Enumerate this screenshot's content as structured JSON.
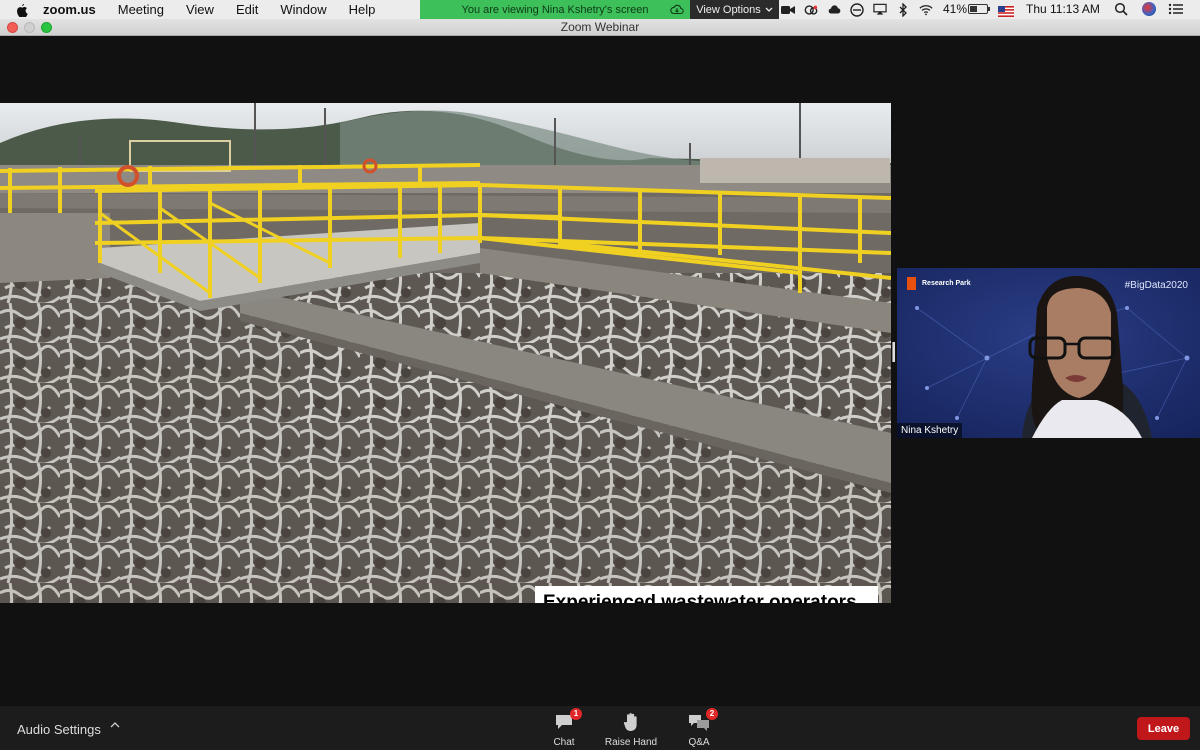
{
  "menubar": {
    "app_name": "zoom.us",
    "items": [
      "Meeting",
      "View",
      "Edit",
      "Window",
      "Help"
    ],
    "share_banner": "You are viewing Nina Kshetry's screen",
    "view_options": "View Options",
    "battery": "41%",
    "clock": "Thu 11:13 AM"
  },
  "window": {
    "title": "Zoom Webinar"
  },
  "shared_screen": {
    "caption": "Experienced wastewater operators are in short supply due to an aging workforce eligible for retirement and a lack of pipeline for new talent."
  },
  "video": {
    "logo_text": "Research Park",
    "hashtag": "#BigData2020",
    "participant_name": "Nina Kshetry"
  },
  "controls": {
    "audio_settings": "Audio Settings",
    "chat_label": "Chat",
    "chat_badge": "1",
    "raise_hand_label": "Raise Hand",
    "qa_label": "Q&A",
    "qa_badge": "2",
    "leave_label": "Leave"
  },
  "colors": {
    "share_banner": "#3dbf5a",
    "leave_button": "#c0171b",
    "badge": "#e02828",
    "railing": "#f0d020"
  }
}
